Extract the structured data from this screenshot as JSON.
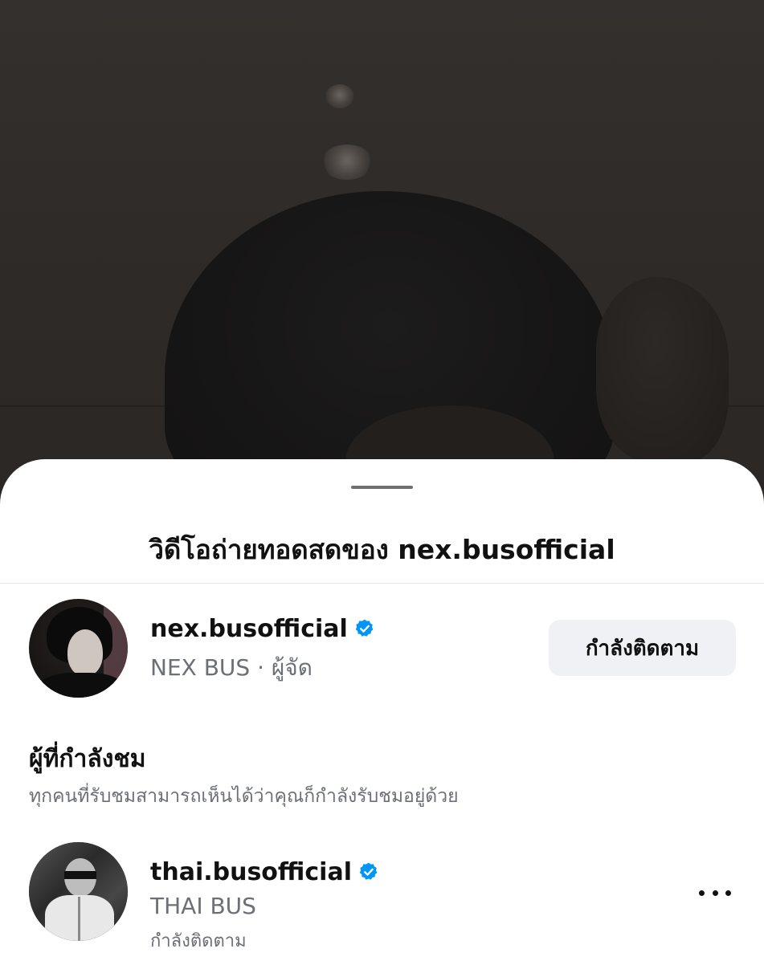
{
  "sheet": {
    "title": "วิดีโอถ่ายทอดสดของ nex.busofficial"
  },
  "host": {
    "username": "nex.busofficial",
    "display_name": "NEX BUS",
    "role_line": "NEX BUS · ผู้จัด",
    "verified": true,
    "follow_button_label": "กำลังติดตาม"
  },
  "viewers_section": {
    "title": "ผู้ที่กำลังชม",
    "description": "ทุกคนที่รับชมสามารถเห็นได้ว่าคุณก็กำลังรับชมอยู่ด้วย",
    "viewers": [
      {
        "username": "thai.busofficial",
        "display_name": "THAI BUS",
        "status": "กำลังติดตาม",
        "verified": true
      }
    ]
  },
  "icons": {
    "verified": "verified-badge-icon",
    "more": "more-horizontal-icon"
  },
  "colors": {
    "verified_blue": "#0095f6",
    "button_bg": "#eff1f4",
    "secondary_text": "#6c6f75"
  }
}
